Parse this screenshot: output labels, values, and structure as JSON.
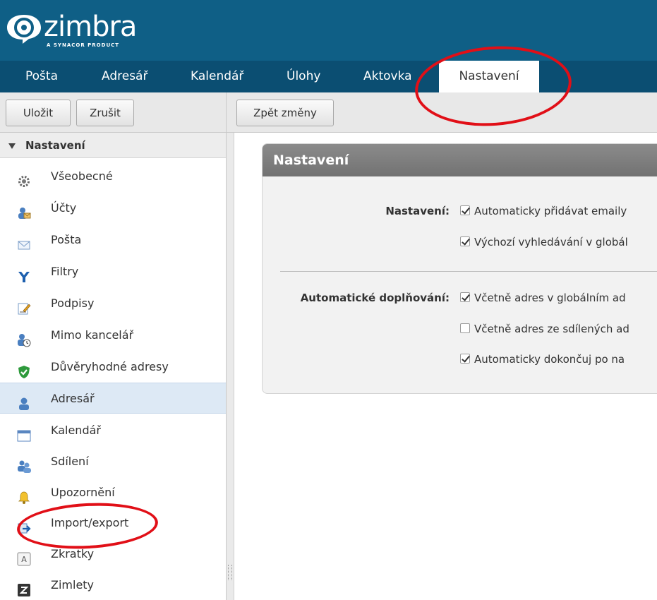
{
  "logo": {
    "word": "zimbra",
    "sub": "A SYNACOR PRODUCT"
  },
  "tabs": [
    {
      "label": "Pošta"
    },
    {
      "label": "Adresář"
    },
    {
      "label": "Kalendář"
    },
    {
      "label": "Úlohy"
    },
    {
      "label": "Aktovka"
    },
    {
      "label": "Nastavení"
    }
  ],
  "toolbar": {
    "save_label": "Uložit",
    "cancel_label": "Zrušit",
    "revert_label": "Zpět změny"
  },
  "sidebar": {
    "header": "Nastavení",
    "items": [
      {
        "label": "Všeobecné",
        "icon": "gear-icon"
      },
      {
        "label": "Účty",
        "icon": "accounts-icon"
      },
      {
        "label": "Pošta",
        "icon": "envelope-icon"
      },
      {
        "label": "Filtry",
        "icon": "filter-icon"
      },
      {
        "label": "Podpisy",
        "icon": "signature-icon"
      },
      {
        "label": "Mimo kancelář",
        "icon": "out-of-office-icon"
      },
      {
        "label": "Důvěryhodné adresy",
        "icon": "shield-check-icon"
      },
      {
        "label": "Adresář",
        "icon": "contact-icon"
      },
      {
        "label": "Kalendář",
        "icon": "calendar-icon"
      },
      {
        "label": "Sdílení",
        "icon": "sharing-icon"
      },
      {
        "label": "Upozornění",
        "icon": "bell-icon"
      },
      {
        "label": "Import/export",
        "icon": "import-export-icon"
      },
      {
        "label": "Zkratky",
        "icon": "shortcuts-icon"
      },
      {
        "label": "Zimlety",
        "icon": "zimlet-icon"
      }
    ],
    "selected_index": 7
  },
  "panel": {
    "title": "Nastavení",
    "section1": {
      "label": "Nastavení:",
      "options": [
        {
          "text": "Automaticky přidávat emaily",
          "checked": true
        },
        {
          "text": "Výchozí vyhledávání v globál",
          "checked": true
        }
      ]
    },
    "section2": {
      "label": "Automatické doplňování:",
      "options": [
        {
          "text": "Včetně adres v globálním ad",
          "checked": true
        },
        {
          "text": "Včetně adres ze sdílených ad",
          "checked": false
        },
        {
          "text": "Automaticky dokončuj po na",
          "checked": true
        }
      ]
    }
  },
  "colors": {
    "header": "#0f5f86",
    "tabbar": "#0b4e72",
    "annotation": "#e10f17",
    "selected": "#dde9f5"
  }
}
